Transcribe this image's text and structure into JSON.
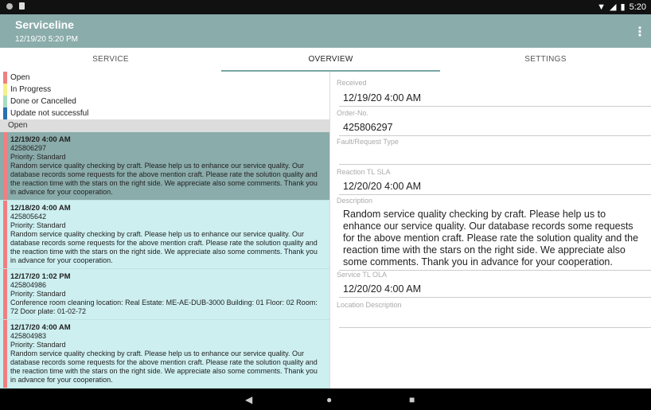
{
  "status": {
    "time": "5:20"
  },
  "appbar": {
    "title": "Serviceline",
    "subtitle": "12/19/20 5:20 PM"
  },
  "tabs": [
    {
      "label": "SERVICE"
    },
    {
      "label": "OVERVIEW"
    },
    {
      "label": "SETTINGS"
    }
  ],
  "legend": [
    {
      "label": "Open",
      "color": "#ef7f80"
    },
    {
      "label": "In Progress",
      "color": "#f6f08a"
    },
    {
      "label": "Done or Cancelled",
      "color": "#a8dcc0"
    },
    {
      "label": "Update not successful",
      "color": "#2a6fb2"
    }
  ],
  "list": {
    "section": "Open",
    "items": [
      {
        "date": "12/19/20 4:00 AM",
        "order": "425806297",
        "priority": "Priority: Standard",
        "desc": "Random service quality checking by craft. Please help us to enhance our service quality. Our database records some requests for the above mention craft. Please rate the solution quality and the reaction time with the stars on the right side. We appreciate also some comments. Thank you in advance for your cooperation."
      },
      {
        "date": "12/18/20 4:00 AM",
        "order": "425805642",
        "priority": "Priority: Standard",
        "desc": "Random service quality checking by craft. Please help us to enhance our service quality. Our database records some requests for the above mention craft. Please rate the solution quality and the reaction time with the stars on the right side. We appreciate also some comments. Thank you in advance for your cooperation."
      },
      {
        "date": "12/17/20 1:02 PM",
        "order": "425804986",
        "priority": "Priority: Standard",
        "desc": "Conference room cleaning location: Real Estate: ME-AE-DUB-3000 Building: 01 Floor: 02 Room: 72 Door plate: 01-02-72"
      },
      {
        "date": "12/17/20 4:00 AM",
        "order": "425804983",
        "priority": "Priority: Standard",
        "desc": "Random service quality checking by craft. Please help us to enhance our service quality. Our database records some requests for the above mention craft. Please rate the solution quality and the reaction time with the stars on the right side. We appreciate also some comments. Thank you in advance for your cooperation."
      }
    ]
  },
  "detail": {
    "received_label": "Received",
    "received": "12/19/20 4:00 AM",
    "order_label": "Order-No.",
    "order": "425806297",
    "fault_label": "Fault/Request Type",
    "fault": "",
    "reaction_label": "Reaction TL SLA",
    "reaction": "12/20/20 4:00 AM",
    "desc_label": "Description",
    "desc": "Random service quality checking by craft. Please help us to enhance our service quality. Our database records some requests for the above mention craft. Please rate the solution quality and the reaction time with the stars on the right side. We appreciate also some comments. Thank you in advance for your cooperation.",
    "ola_label": "Service TL OLA",
    "ola": "12/20/20 4:00 AM",
    "location_label": "Location Description",
    "location": ""
  }
}
